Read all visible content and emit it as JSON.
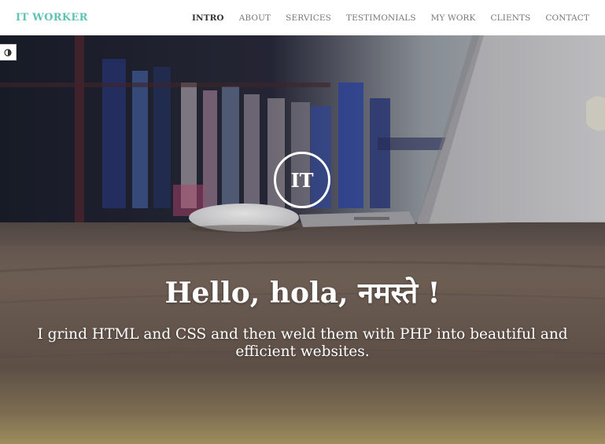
{
  "navbar": {
    "brand": "IT WORKER",
    "brand_color": "#5fc4b3",
    "links": [
      {
        "label": "INTRO",
        "active": true
      },
      {
        "label": "ABOUT"
      },
      {
        "label": "SERVICES"
      },
      {
        "label": "TESTIMONIALS"
      },
      {
        "label": "MY WORK"
      },
      {
        "label": "CLIENTS"
      },
      {
        "label": "CONTACT"
      }
    ]
  },
  "theme_toggle": {
    "icon": "half-circle-contrast-icon"
  },
  "hero": {
    "logo_text": "IT",
    "headline": "Hello, hola, नमस्ते !",
    "tagline": "I grind HTML and CSS and then weld them with PHP into beautiful and efficient websites."
  }
}
